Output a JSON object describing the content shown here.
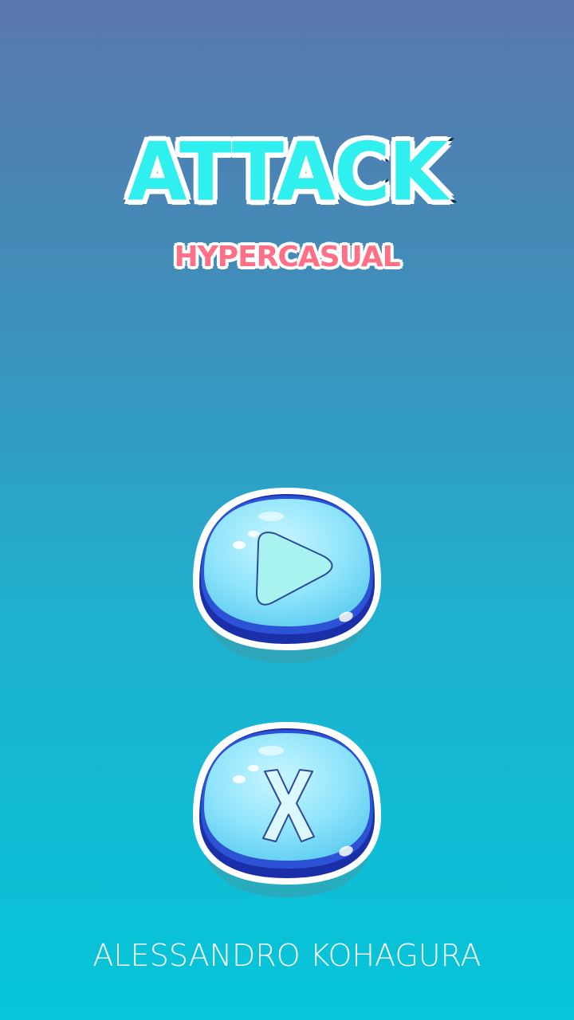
{
  "title": {
    "main": "ATTACK",
    "sub": "HYPERCASUAL"
  },
  "buttons": {
    "play": {
      "icon": "play-icon"
    },
    "quit": {
      "icon": "close-icon"
    }
  },
  "footer": {
    "author": "ALESSANDRO KOHAGURA"
  },
  "colors": {
    "background_top": "#5a77ad",
    "background_bottom": "#05c6da",
    "title_fill": "#2ff0ee",
    "subtitle_fill": "#ff6f86",
    "button_body": "#8fe4fb",
    "button_rim": "#1a2fa8"
  }
}
